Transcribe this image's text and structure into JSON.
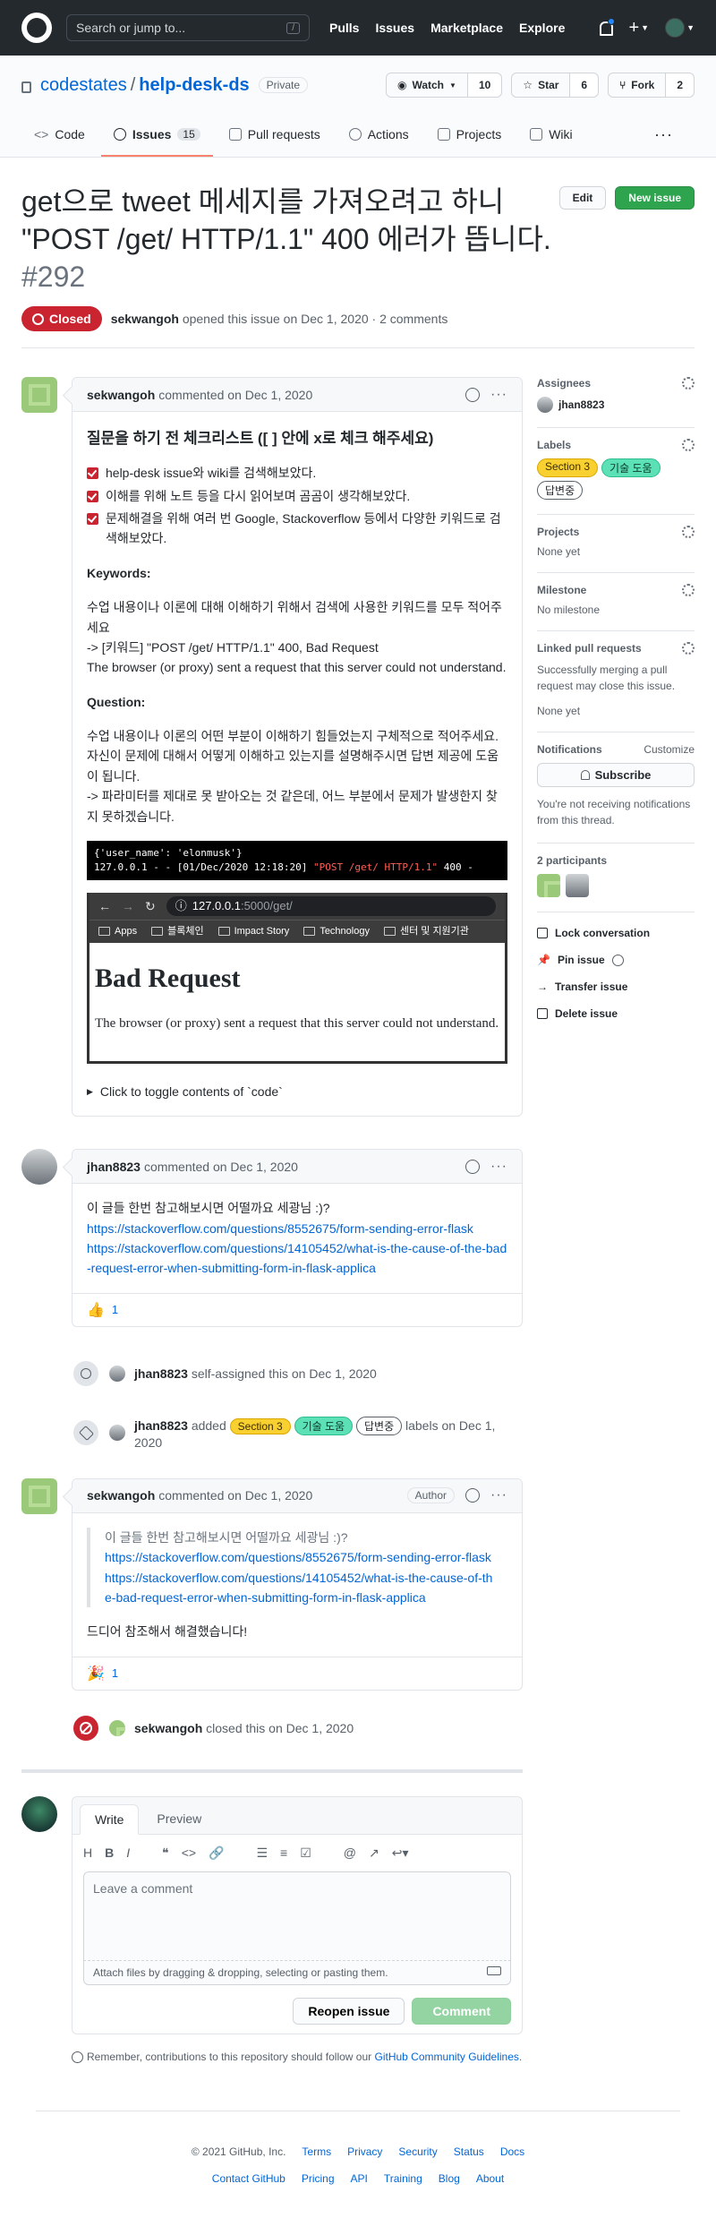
{
  "header": {
    "search_placeholder": "Search or jump to...",
    "slash_key": "/",
    "nav": [
      "Pulls",
      "Issues",
      "Marketplace",
      "Explore"
    ]
  },
  "repo": {
    "owner": "codestates",
    "name": "help-desk-ds",
    "visibility": "Private",
    "watch_label": "Watch",
    "watch_count": "10",
    "star_label": "Star",
    "star_count": "6",
    "fork_label": "Fork",
    "fork_count": "2",
    "tabs": [
      {
        "label": "Code"
      },
      {
        "label": "Issues",
        "count": "15"
      },
      {
        "label": "Pull requests"
      },
      {
        "label": "Actions"
      },
      {
        "label": "Projects"
      },
      {
        "label": "Wiki"
      }
    ]
  },
  "issue": {
    "title": "get으로 tweet 메세지를 가져오려고 하니 \"POST /get/ HTTP/1.1\" 400 에러가 뜹니다.",
    "number": "#292",
    "state": "Closed",
    "edit_label": "Edit",
    "new_issue_label": "New issue",
    "author": "sekwangoh",
    "meta": "opened this issue on Dec 1, 2020 · 2 comments"
  },
  "first_comment": {
    "author": "sekwangoh",
    "date": "commented on Dec 1, 2020",
    "heading": "질문을 하기 전 체크리스트 ([ ] 안에 x로 체크 해주세요)",
    "checklist": [
      "help-desk issue와 wiki를 검색해보았다.",
      "이해를 위해 노트 등을 다시 읽어보며 곰곰이 생각해보았다.",
      "문제해결을 위해 여러 번 Google, Stackoverflow 등에서 다양한 키워드로 검색해보았다."
    ],
    "keywords_heading": "Keywords:",
    "keywords_line1": "수업 내용이나 이론에 대해 이해하기 위해서 검색에 사용한 키워드를 모두 적어주세요",
    "keywords_line2": "-> [키워드] \"POST /get/ HTTP/1.1\" 400, Bad Request",
    "keywords_line3": "The browser (or proxy) sent a request that this server could not understand.",
    "question_heading": "Question:",
    "question_text": "수업 내용이나 이론의 어떤 부분이 이해하기 힘들었는지 구체적으로 적어주세요. 자신이 문제에 대해서 어떻게 이해하고 있는지를 설명해주시면 답변 제공에 도움이 됩니다.",
    "question_text2": "-> 파라미터를 제대로 못 받아오는 것 같은데, 어느 부분에서 문제가 발생한지 찾지 못하겠습니다.",
    "code_line1": "{'user_name': 'elonmusk'}",
    "code_line2_prefix": "127.0.0.1 - - [01/Dec/2020 12:18:20] ",
    "code_line2_red": "\"POST /get/ HTTP/1.1\"",
    "code_line2_suffix": " 400 -",
    "browser_url_host": "127.0.0.1",
    "browser_url_path": ":5000/get/",
    "bookmarks": [
      "Apps",
      "블록체인",
      "Impact Story",
      "Technology",
      "센터 및 지원기관"
    ],
    "error_title": "Bad Request",
    "error_text": "The browser (or proxy) sent a request that this server could not understand.",
    "details_summary": "Click to toggle contents of `code`"
  },
  "second_comment": {
    "author": "jhan8823",
    "date": "commented on Dec 1, 2020",
    "text": "이 글들 한번 참고해보시면 어떨까요 세광님 :)?",
    "link1": "https://stackoverflow.com/questions/8552675/form-sending-error-flask",
    "link2": "https://stackoverflow.com/questions/14105452/what-is-the-cause-of-the-bad-request-error-when-submitting-form-in-flask-applica",
    "reaction_emoji": "👍",
    "reaction_count": "1"
  },
  "events": {
    "assign_actor": "jhan8823",
    "assign_text": "self-assigned this on Dec 1, 2020",
    "label_actor": "jhan8823",
    "label_added": "added",
    "label_suffix": "labels on Dec 1, 2020",
    "close_actor": "sekwangoh",
    "close_text": "closed this on Dec 1, 2020"
  },
  "labels": {
    "section": "Section 3",
    "tech": "기술 도움",
    "answer": "답변중"
  },
  "third_comment": {
    "author": "sekwangoh",
    "date": "commented on Dec 1, 2020",
    "badge": "Author",
    "quote": "이 글들 한번 참고해보시면 어떨까요 세광님 :)?",
    "link1": "https://stackoverflow.com/questions/8552675/form-sending-error-flask",
    "link2": "https://stackoverflow.com/questions/14105452/what-is-the-cause-of-the-bad-request-error-when-submitting-form-in-flask-applica",
    "text": "드디어 참조해서 해결했습니다!",
    "reaction_emoji": "🎉",
    "reaction_count": "1"
  },
  "composer": {
    "write_tab": "Write",
    "preview_tab": "Preview",
    "placeholder": "Leave a comment",
    "drop_hint": "Attach files by dragging & dropping, selecting or pasting them.",
    "reopen_label": "Reopen issue",
    "comment_label": "Comment",
    "guidelines_prefix": "Remember, contributions to this repository should follow our",
    "guidelines_link": "GitHub Community Guidelines",
    "guidelines_suffix": "."
  },
  "sidebar": {
    "assignees_label": "Assignees",
    "assignee": "jhan8823",
    "labels_label": "Labels",
    "projects_label": "Projects",
    "projects_value": "None yet",
    "milestone_label": "Milestone",
    "milestone_value": "No milestone",
    "linked_label": "Linked pull requests",
    "linked_desc": "Successfully merging a pull request may close this issue.",
    "linked_value": "None yet",
    "notifications_label": "Notifications",
    "customize": "Customize",
    "subscribe": "Subscribe",
    "notif_desc": "You're not receiving notifications from this thread.",
    "participants_label": "2 participants",
    "actions": [
      "Lock conversation",
      "Pin issue",
      "Transfer issue",
      "Delete issue"
    ]
  },
  "footer": {
    "copyright": "© 2021 GitHub, Inc.",
    "row1": [
      "Terms",
      "Privacy",
      "Security",
      "Status",
      "Docs"
    ],
    "row2": [
      "Contact GitHub",
      "Pricing",
      "API",
      "Training",
      "Blog",
      "About"
    ]
  },
  "colors": {
    "closed": "#cb2431",
    "green": "#2ea44f",
    "link": "#0366d6",
    "section_label": "#f8d030",
    "tech_label": "#5ce0b5"
  }
}
